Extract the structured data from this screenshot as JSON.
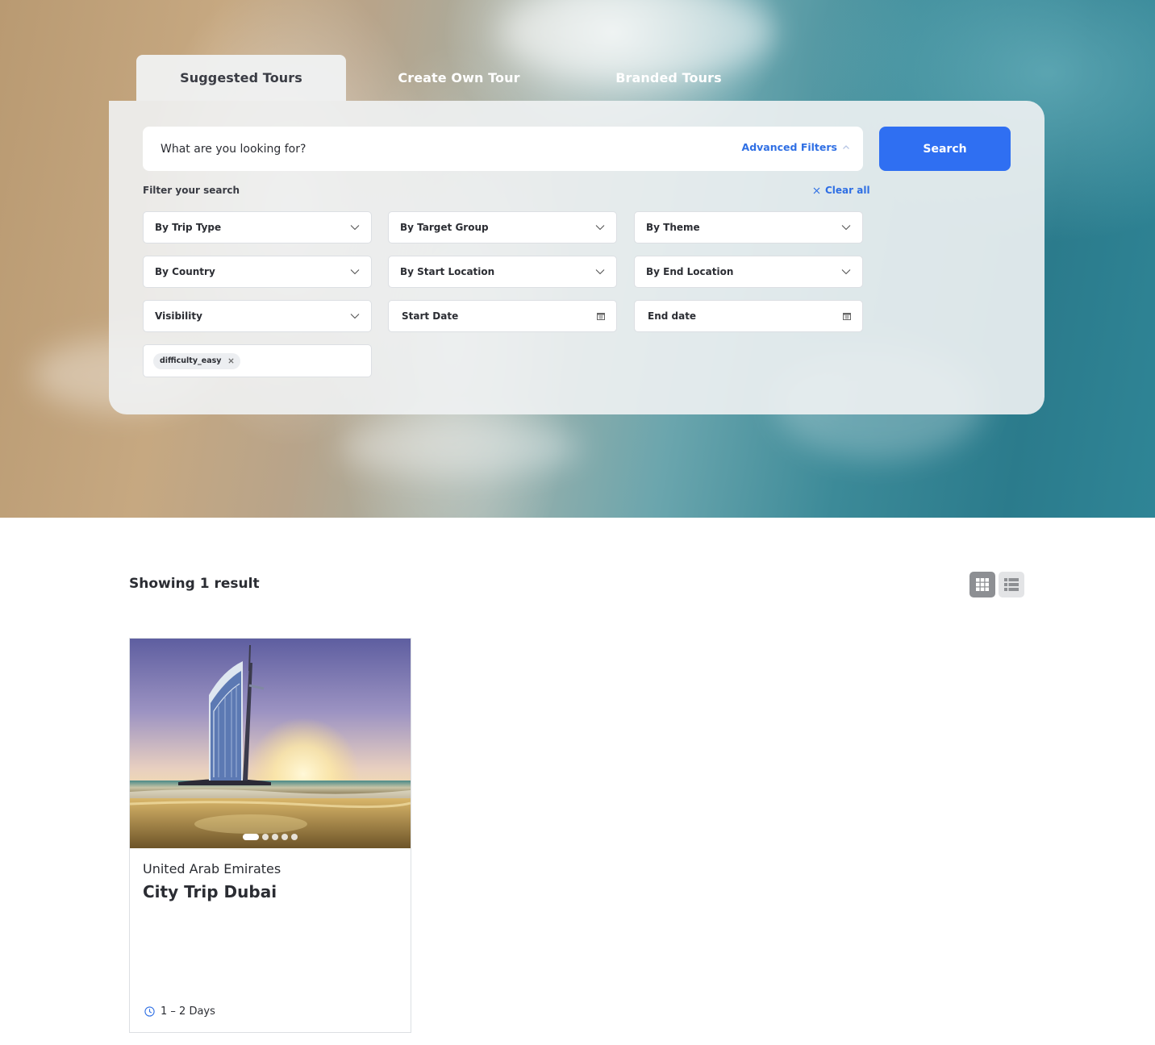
{
  "tabs": [
    {
      "label": "Suggested Tours",
      "active": true
    },
    {
      "label": "Create Own Tour",
      "active": false
    },
    {
      "label": "Branded Tours",
      "active": false
    }
  ],
  "search": {
    "placeholder": "What are you looking for?",
    "advanced_filters_label": "Advanced Filters",
    "button_label": "Search"
  },
  "filters": {
    "heading": "Filter your search",
    "clear_all_label": "Clear all",
    "dropdowns": {
      "trip_type": "By Trip Type",
      "target_group": "By Target Group",
      "theme": "By Theme",
      "country": "By Country",
      "start_location": "By Start Location",
      "end_location": "By End Location",
      "visibility": "Visibility"
    },
    "dates": {
      "start_placeholder": "Start Date",
      "end_placeholder": "End date"
    },
    "active_tags": [
      "difficulty_easy"
    ]
  },
  "results": {
    "count_label": "Showing 1 result",
    "view_modes": [
      "grid-icon",
      "list-icon"
    ],
    "active_view": "grid"
  },
  "cards": [
    {
      "country": "United Arab Emirates",
      "title": "City Trip Dubai",
      "duration": "1 – 2 Days",
      "image_slides": 5,
      "active_slide": 1
    }
  ],
  "colors": {
    "accent": "#2f6ff2",
    "link": "#2f6fe4",
    "text": "#2b2d33"
  }
}
